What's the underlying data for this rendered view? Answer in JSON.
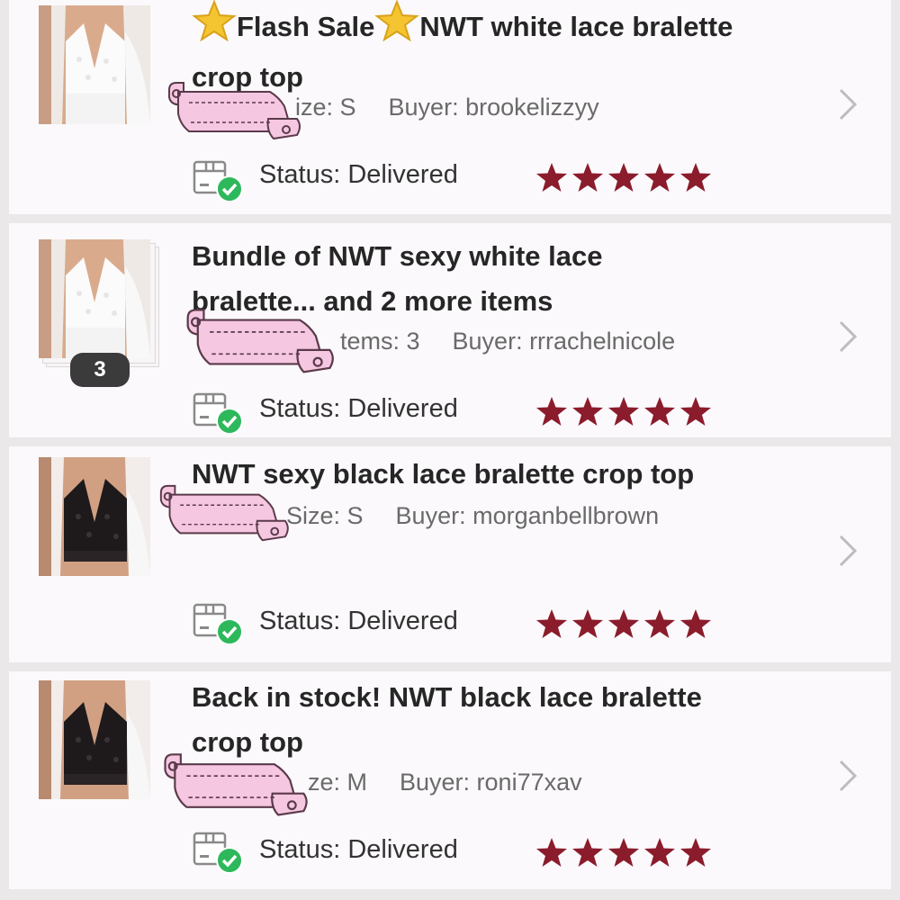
{
  "orders": [
    {
      "title_prefix": "Flash Sale",
      "title_middle": "NWT white lace bralette",
      "title_line2": "crop top",
      "meta_label": "ize: S",
      "buyer_label": "Buyer: brookelizzyy",
      "status": "Status:  Delivered",
      "rating": 5,
      "thumb": "white-lace-bralette-photo"
    },
    {
      "title_line1": "Bundle of NWT sexy white lace",
      "title_line2": "bralette... and 2 more items",
      "meta_label": "tems: 3",
      "buyer_label": "Buyer: rrrachelnicole",
      "badge_count": "3",
      "status": "Status:  Delivered",
      "rating": 5,
      "thumb": "white-lace-bralette-photo"
    },
    {
      "title_line1": "NWT sexy black lace bralette crop top",
      "meta_label": "Size: S",
      "buyer_label": "Buyer: morganbellbrown",
      "status": "Status:  Delivered",
      "rating": 5,
      "thumb": "black-lace-bralette-photo"
    },
    {
      "title_line1": "Back in stock! NWT black lace bralette",
      "title_line2": "crop top",
      "meta_label": "ze: M",
      "buyer_label": "Buyer: roni77xav",
      "status": "Status:  Delivered",
      "rating": 5,
      "thumb": "black-lace-bralette-photo"
    }
  ],
  "colors": {
    "star": "#8b1c2c",
    "check": "#2eb85c",
    "scroll_fill": "#f6c7e1",
    "title_star": "#f5c431",
    "chevron": "#bdbdbd"
  },
  "icons": [
    "star-icon",
    "delivered-box-icon",
    "chevron-right-icon",
    "scroll-banner-sticker"
  ]
}
